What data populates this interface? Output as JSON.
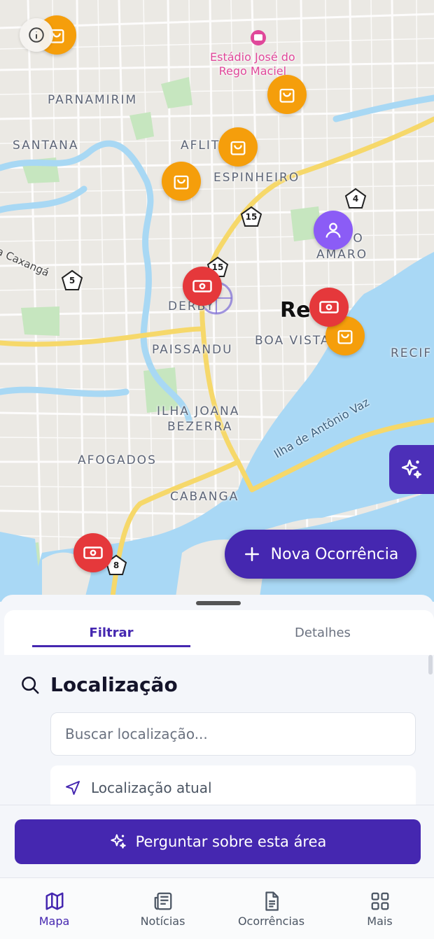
{
  "map": {
    "labels": {
      "parnamirim": "PARNAMIRIM",
      "santana": "SANTANA",
      "aflitos": "AFLIT",
      "espinheiro": "ESPINHEIRO",
      "santo_amaro_1": "TO",
      "santo_amaro_2": "AMARO",
      "derby": "DERBY",
      "paissandu": "PAISSANDU",
      "boa_vista": "BOA VISTA",
      "recife_city": "Rec",
      "recife_bairro": "RECIF",
      "ilha_joana_1": "ILHA JOANA",
      "ilha_joana_2": "BEZERRA",
      "afogados": "AFOGADOS",
      "cabanga": "CABANGA",
      "caxanga": "a Caxangá",
      "ilha_antonio_vaz": "Ilha de Antônio Vaz",
      "estadio_1": "Estádio José do",
      "estadio_2": "Rego Maciel"
    },
    "route_shields": [
      "4",
      "15",
      "15",
      "5",
      "8"
    ],
    "marker_types": {
      "bag": "shopping-bag-icon",
      "money": "money-icon",
      "user": "user-icon"
    },
    "colors": {
      "bag": "#f59e0b",
      "money": "#e5383b",
      "user": "#8b5cf6",
      "primary": "#4527b0",
      "water": "#a9d8f5",
      "park": "#c8e6c0",
      "highway": "#f8da6a"
    }
  },
  "new_occurrence_label": "Nova Ocorrência",
  "sheet": {
    "tabs": [
      "Filtrar",
      "Detalhes"
    ],
    "active_tab": "Filtrar",
    "section_title": "Localização",
    "search_placeholder": "Buscar localização...",
    "current_location_label": "Localização atual",
    "ask_button_label": "Perguntar sobre esta área"
  },
  "bottom_nav": {
    "items": [
      {
        "label": "Mapa",
        "icon": "map-icon",
        "active": true
      },
      {
        "label": "Notícias",
        "icon": "newspaper-icon",
        "active": false
      },
      {
        "label": "Ocorrências",
        "icon": "document-icon",
        "active": false
      },
      {
        "label": "Mais",
        "icon": "grid-icon",
        "active": false
      }
    ]
  }
}
